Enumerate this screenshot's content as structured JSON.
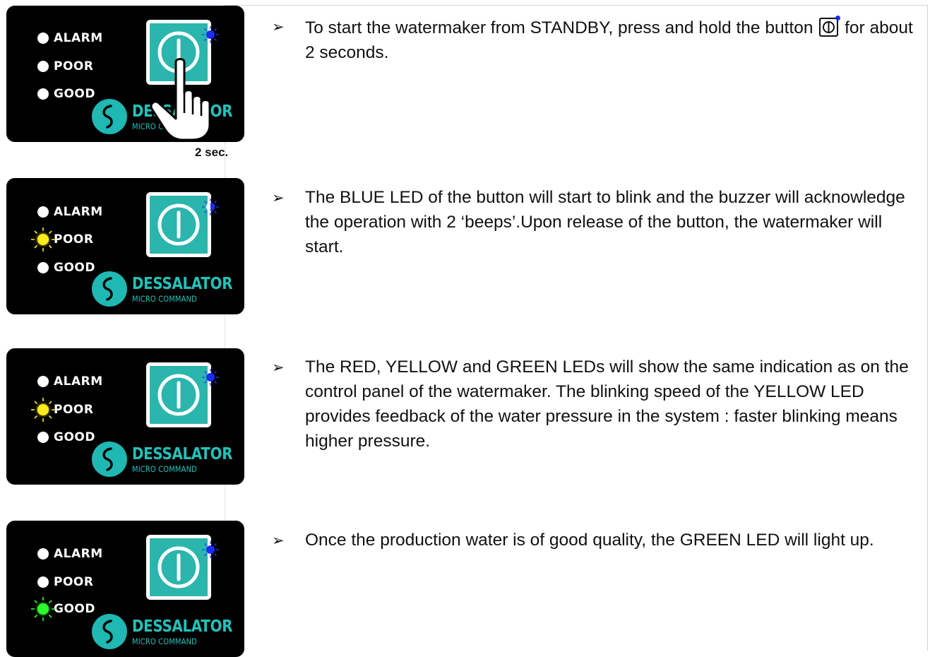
{
  "panel": {
    "led_labels": [
      "ALARM",
      "POOR",
      "GOOD"
    ],
    "brand": "DESSALATOR",
    "sub_brand": "MICRO COMMAND",
    "button_icon": "power-icon",
    "colors": {
      "panel_bg": "#000000",
      "teal": "#2ab5ad",
      "blue_led": "#1a2cff",
      "yellow_led": "#ffec1a",
      "green_led": "#2bff2b"
    }
  },
  "steps": [
    {
      "lit_led": "none",
      "blue_led": "on",
      "caption": "2 sec.",
      "text_before": "To start the watermaker from STANDBY, press and hold the button",
      "text_after": "for about 2 seconds."
    },
    {
      "lit_led": "POOR",
      "blue_led": "blinking",
      "text": "The BLUE LED of the button will start to blink and the buzzer will acknowledge the operation with 2 ‘beeps’.Upon release of the button, the watermaker will start."
    },
    {
      "lit_led": "POOR",
      "blue_led": "on",
      "text": "The RED, YELLOW and GREEN LEDs will show the same indication as on the control panel of the watermaker. The blinking speed of the YELLOW LED provides feedback of the water pressure in the system : faster blinking means higher pressure."
    },
    {
      "lit_led": "GOOD",
      "blue_led": "on",
      "text": "Once the production water is of good quality, the GREEN LED will light up."
    }
  ],
  "bullet_symbol": "➢"
}
